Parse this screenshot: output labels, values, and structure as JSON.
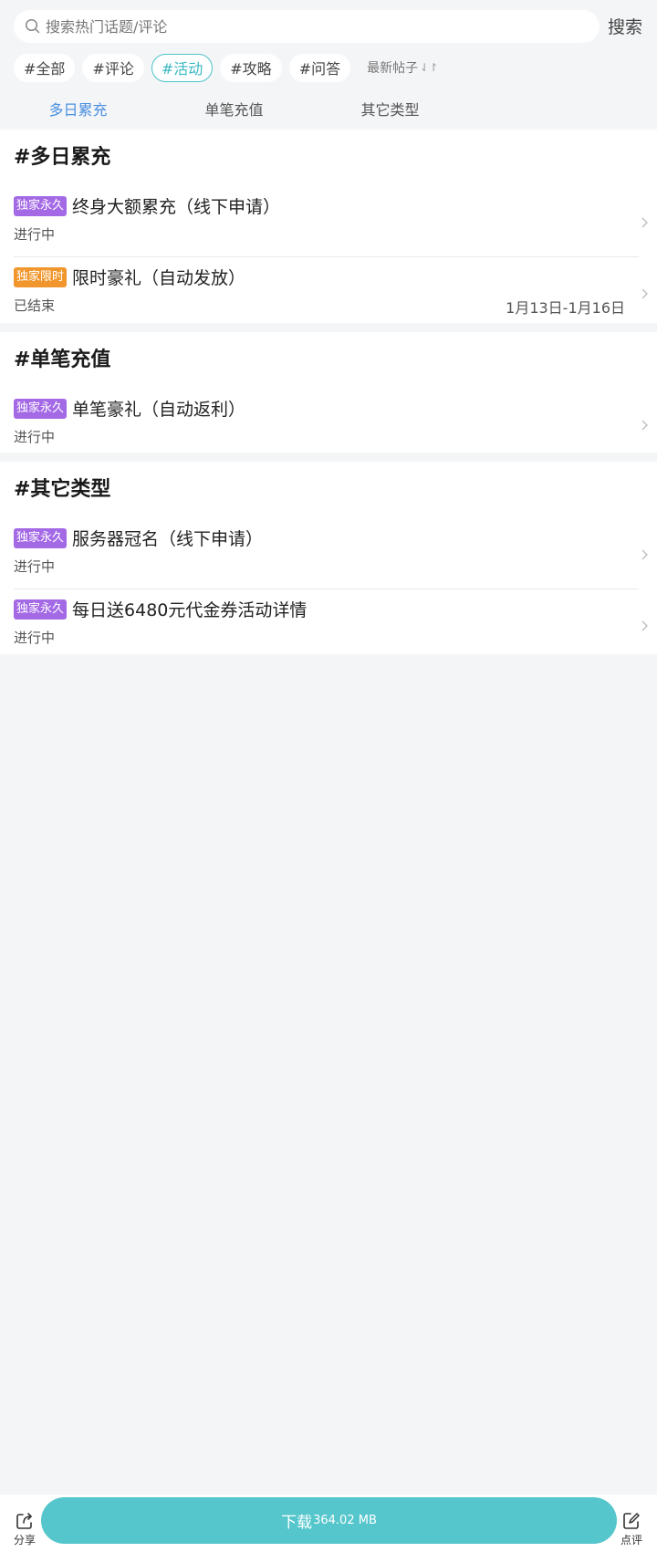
{
  "search": {
    "placeholder": "搜索热门话题/评论",
    "button_label": "搜索",
    "icon": "search-icon"
  },
  "filters": {
    "chips": [
      {
        "label": "#全部",
        "active": false
      },
      {
        "label": "#评论",
        "active": false
      },
      {
        "label": "#活动",
        "active": true
      },
      {
        "label": "#攻略",
        "active": false
      },
      {
        "label": "#问答",
        "active": false
      }
    ],
    "sort_label": "最新帖子",
    "sort_icon": "sort-arrows-icon"
  },
  "tabs": [
    {
      "label": "多日累充",
      "active": true
    },
    {
      "label": "单笔充值",
      "active": false
    },
    {
      "label": "其它类型",
      "active": false
    }
  ],
  "sections": [
    {
      "title": "#多日累充",
      "items": [
        {
          "badge": "独家永久",
          "badge_color": "#a46ae6",
          "title": "终身大额累充（线下申请）",
          "status": "进行中",
          "date": ""
        },
        {
          "badge": "独家限时",
          "badge_color": "#f0962c",
          "title": "限时豪礼（自动发放）",
          "status": "已结束",
          "date": "1月13日-1月16日"
        }
      ]
    },
    {
      "title": "#单笔充值",
      "items": [
        {
          "badge": "独家永久",
          "badge_color": "#a46ae6",
          "title": "单笔豪礼（自动返利）",
          "status": "进行中",
          "date": ""
        }
      ]
    },
    {
      "title": "#其它类型",
      "items": [
        {
          "badge": "独家永久",
          "badge_color": "#a46ae6",
          "title": "服务器冠名（线下申请）",
          "status": "进行中",
          "date": ""
        },
        {
          "badge": "独家永久",
          "badge_color": "#a46ae6",
          "title": "每日送6480元代金券活动详情",
          "status": "进行中",
          "date": ""
        }
      ]
    }
  ],
  "bottom_bar": {
    "share_label": "分享",
    "download_label": "下载",
    "download_size": "364.02 MB",
    "review_label": "点评",
    "accent_color": "#55c6cc"
  }
}
